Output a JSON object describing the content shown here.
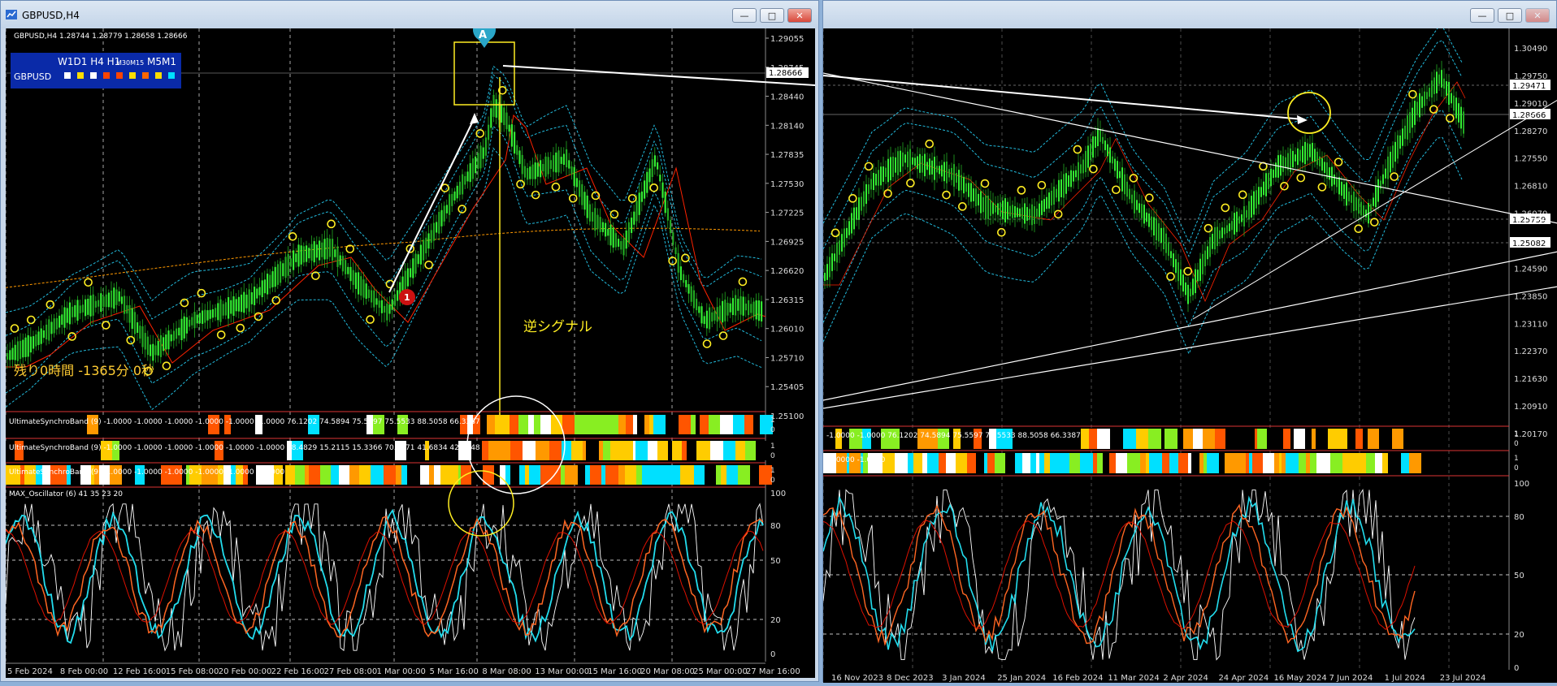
{
  "left": {
    "window_title": "GBPUSD,H4",
    "header": {
      "symbol": "GBPUSD,H4",
      "ohlc": "1.28744 1.28779 1.28658 1.28666"
    },
    "mtf_panel": {
      "tf_label": "W1D1 H4 H1",
      "tf_small": "M30M15",
      "tf_tail": "M5M1",
      "symbol": "GBPUSD",
      "dots": [
        "#ffffff",
        "#ffdd00",
        "#ffffff",
        "#ff4400",
        "#ff4400",
        "#ffdd00",
        "#ff6600",
        "#ffdd00",
        "#00e0ff"
      ]
    },
    "countdown": "残り0時間 -1365分 0秒",
    "annotation_text": "逆シグナル",
    "marker_a": "A",
    "marker_1": "1",
    "price_axis": [
      "1.29055",
      "1.28745",
      "1.28440",
      "1.28140",
      "1.27835",
      "1.27530",
      "1.27225",
      "1.26925",
      "1.26620",
      "1.26315",
      "1.26010",
      "1.25710",
      "1.25405",
      "1.25100"
    ],
    "current_price": "1.28666",
    "band_rows": [
      {
        "label": "UltimateSynchroBand (9) -1.0000 -1.0000 -1.0000 -1.0000 -1.0000 -1.0000 76.1202 74.5894 75.5597 75.5533 88.5058 66.3387",
        "axis": [
          "1",
          "0"
        ]
      },
      {
        "label": "UltimateSynchroBand (9) -1.0000 -1.0000 -1.0000 -1.0000 -1.0000 -1.0000 38.4829 15.2115 15.3366 70.6171 41.6834 42.1948",
        "axis": [
          "1",
          "0"
        ]
      },
      {
        "label": "UltimateSynchroBand (9) -1.0000 -1.0000 -1.0000 -1.0000 -1.0000 -1.0000",
        "axis": [
          "1",
          "0"
        ]
      }
    ],
    "oscillator": {
      "label": "MAX_Oscillator (6) 41 35 23 20",
      "levels": [
        "100",
        "80",
        "50",
        "20",
        "0"
      ]
    },
    "time_axis": [
      "5 Feb 2024",
      "8 Feb 00:00",
      "12 Feb 16:00",
      "15 Feb 08:00",
      "20 Feb 00:00",
      "22 Feb 16:00",
      "27 Feb 08:00",
      "1 Mar 00:00",
      "5 Mar 16:00",
      "8 Mar 08:00",
      "13 Mar 00:00",
      "15 Mar 16:00",
      "20 Mar 08:00",
      "25 Mar 00:00",
      "27 Mar 16:00"
    ]
  },
  "right": {
    "price_axis": [
      "1.30490",
      "1.29750",
      "1.29010",
      "1.28270",
      "1.27550",
      "1.26810",
      "1.26070",
      "1.25330",
      "1.24590",
      "1.23850",
      "1.23110",
      "1.22370",
      "1.21630",
      "1.20910",
      "1.20170"
    ],
    "price_labels": [
      "1.29471",
      "1.28666",
      "1.25759",
      "1.25082"
    ],
    "band_rows": [
      {
        "label": "-1.0000 -1.0000 76.1202 74.5894 75.5597 75.5533 88.5058 66.3387",
        "axis": [
          "1",
          "0"
        ]
      },
      {
        "label": "-1.0000 -1.0000",
        "axis": [
          "1",
          "0"
        ]
      }
    ],
    "oscillator_levels": [
      "100",
      "80",
      "50",
      "20",
      "0"
    ],
    "time_axis": [
      "16 Nov 2023",
      "8 Dec 2023",
      "3 Jan 2024",
      "25 Jan 2024",
      "16 Feb 2024",
      "11 Mar 2024",
      "2 Apr 2024",
      "24 Apr 2024",
      "16 May 2024",
      "7 Jun 2024",
      "1 Jul 2024",
      "23 Jul 2024"
    ]
  },
  "colors": {
    "bull": "#33ee33",
    "bear": "#22aa22",
    "band": "#22bbdd",
    "signal": "#ffee22",
    "ma_red": "#ff2200",
    "osc_cyan": "#22ddee",
    "osc_orange": "#ff6622"
  },
  "window_buttons": {
    "min": "—",
    "max": "□",
    "close": "✕"
  }
}
